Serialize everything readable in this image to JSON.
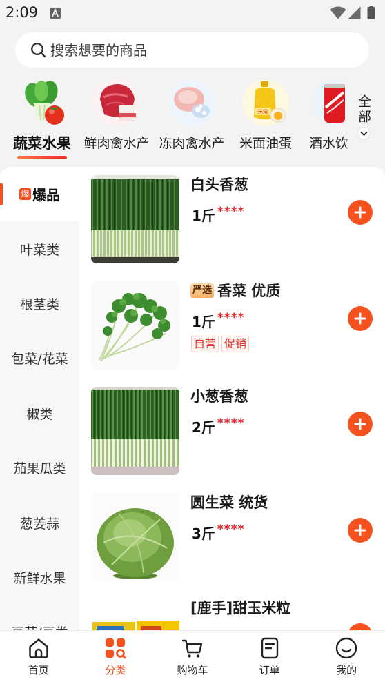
{
  "status_bar": {
    "time": "2:09",
    "icons": [
      "a-notification-icon",
      "wifi-icon",
      "signal-icon",
      "battery-icon"
    ]
  },
  "search": {
    "placeholder": "搜索想要的商品",
    "icon": "search-icon"
  },
  "categories": [
    {
      "label": "蔬菜水果",
      "selected": true,
      "icon": "vegetables-fruit-icon"
    },
    {
      "label": "鲜肉禽水产",
      "selected": false,
      "icon": "fresh-meat-icon"
    },
    {
      "label": "冻肉禽水产",
      "selected": false,
      "icon": "frozen-meat-icon"
    },
    {
      "label": "米面油蛋",
      "selected": false,
      "icon": "rice-oil-egg-icon",
      "logo_text": "元宝"
    },
    {
      "label": "酒水饮",
      "selected": false,
      "icon": "drinks-can-icon"
    }
  ],
  "all_categories": {
    "label": "全部",
    "icon": "chevron-down-icon"
  },
  "sidebar": {
    "items": [
      {
        "label": "爆品",
        "badge": "爆",
        "selected": true
      },
      {
        "label": "叶菜类",
        "selected": false
      },
      {
        "label": "根茎类",
        "selected": false
      },
      {
        "label": "包菜/花菜",
        "selected": false
      },
      {
        "label": "椒类",
        "selected": false
      },
      {
        "label": "茄果瓜类",
        "selected": false
      },
      {
        "label": "葱姜蒜",
        "selected": false
      },
      {
        "label": "新鲜水果",
        "selected": false
      },
      {
        "label": "豆芽/豆类",
        "selected": false
      }
    ]
  },
  "products": [
    {
      "name": "白头香葱",
      "unit": "1斤",
      "price": "****",
      "image": "green-onion-image"
    },
    {
      "badge": "严选",
      "name": "香菜 优质",
      "unit": "1斤",
      "price": "****",
      "tags": [
        "自营",
        "促销"
      ],
      "image": "cilantro-image"
    },
    {
      "name": "小葱香葱",
      "unit": "2斤",
      "price": "****",
      "image": "scallion-image"
    },
    {
      "name": "圆生菜 统货",
      "unit": "3斤",
      "price": "****",
      "image": "lettuce-image"
    },
    {
      "name": "[鹿手]甜玉米粒",
      "image": "sweet-corn-image"
    }
  ],
  "bottom_nav": [
    {
      "label": "首页",
      "icon": "home-icon",
      "active": false
    },
    {
      "label": "分类",
      "icon": "category-icon",
      "active": true
    },
    {
      "label": "购物车",
      "icon": "cart-icon",
      "active": false
    },
    {
      "label": "订单",
      "icon": "order-icon",
      "active": false
    },
    {
      "label": "我的",
      "icon": "profile-icon",
      "active": false
    }
  ],
  "colors": {
    "accent": "#f5511e",
    "price": "#e8242b",
    "background": "#f3f3f3",
    "sidebar_background": "#f7f7f7"
  }
}
